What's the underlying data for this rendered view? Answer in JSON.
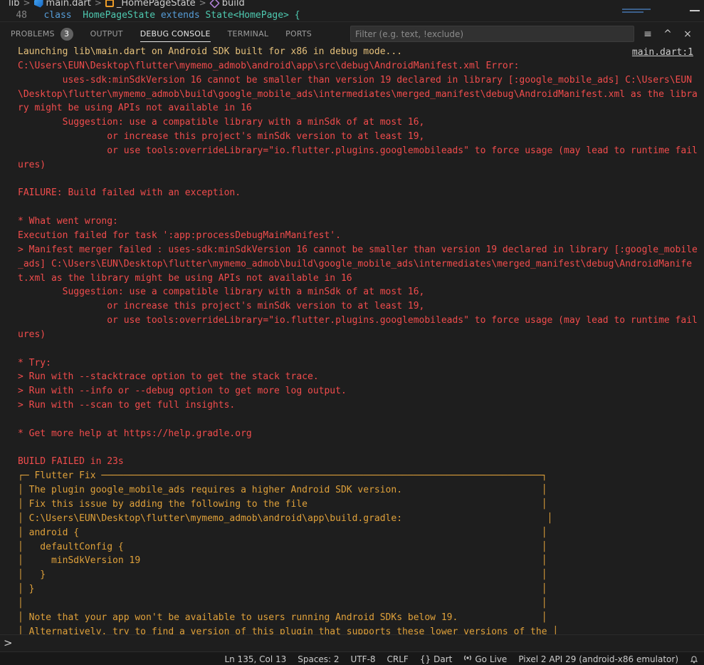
{
  "breadcrumb": {
    "items": [
      "lib",
      "main.dart",
      "_HomePageState",
      "build"
    ],
    "separator": ">"
  },
  "editor": {
    "line_number": "48",
    "code_keyword": "class",
    "code_rest_type": "HomePageState",
    "code_extends": "extends",
    "code_state": "State<HomePage> {"
  },
  "panel": {
    "tabs": [
      {
        "label": "PROBLEMS",
        "badge": "3"
      },
      {
        "label": "OUTPUT"
      },
      {
        "label": "DEBUG CONSOLE",
        "active": true
      },
      {
        "label": "TERMINAL"
      },
      {
        "label": "PORTS"
      }
    ],
    "filter_placeholder": "Filter (e.g. text, !exclude)",
    "actions": {
      "menu": "≡",
      "maximize": "^",
      "close": "×"
    }
  },
  "console": {
    "source_link": "main.dart:1",
    "lines": [
      {
        "text": "Launching lib\\main.dart on Android SDK built for x86 in debug mode...",
        "color": "yellow"
      },
      {
        "text": "C:\\Users\\EUN\\Desktop\\flutter\\mymemo_admob\\android\\app\\src\\debug\\AndroidManifest.xml Error:",
        "color": "red"
      },
      {
        "text": "        uses-sdk:minSdkVersion 16 cannot be smaller than version 19 declared in library [:google_mobile_ads] C:\\Users\\EUN",
        "color": "red"
      },
      {
        "text": "\\Desktop\\flutter\\mymemo_admob\\build\\google_mobile_ads\\intermediates\\merged_manifest\\debug\\AndroidManifest.xml as the libra",
        "color": "red"
      },
      {
        "text": "ry might be using APIs not available in 16",
        "color": "red"
      },
      {
        "text": "        Suggestion: use a compatible library with a minSdk of at most 16,",
        "color": "red"
      },
      {
        "text": "                or increase this project's minSdk version to at least 19,",
        "color": "red"
      },
      {
        "text": "                or use tools:overrideLibrary=\"io.flutter.plugins.googlemobileads\" to force usage (may lead to runtime fail",
        "color": "red"
      },
      {
        "text": "ures)",
        "color": "red"
      },
      {
        "text": "",
        "color": "red"
      },
      {
        "text": "FAILURE: Build failed with an exception.",
        "color": "red"
      },
      {
        "text": "",
        "color": "red"
      },
      {
        "text": "* What went wrong:",
        "color": "red"
      },
      {
        "text": "Execution failed for task ':app:processDebugMainManifest'.",
        "color": "red"
      },
      {
        "text": "> Manifest merger failed : uses-sdk:minSdkVersion 16 cannot be smaller than version 19 declared in library [:google_mobile",
        "color": "red"
      },
      {
        "text": "_ads] C:\\Users\\EUN\\Desktop\\flutter\\mymemo_admob\\build\\google_mobile_ads\\intermediates\\merged_manifest\\debug\\AndroidManife",
        "color": "red"
      },
      {
        "text": "t.xml as the library might be using APIs not available in 16",
        "color": "red"
      },
      {
        "text": "        Suggestion: use a compatible library with a minSdk of at most 16,",
        "color": "red"
      },
      {
        "text": "                or increase this project's minSdk version to at least 19,",
        "color": "red"
      },
      {
        "text": "                or use tools:overrideLibrary=\"io.flutter.plugins.googlemobileads\" to force usage (may lead to runtime fail",
        "color": "red"
      },
      {
        "text": "ures)",
        "color": "red"
      },
      {
        "text": "",
        "color": "red"
      },
      {
        "text": "* Try:",
        "color": "red"
      },
      {
        "text": "> Run with --stacktrace option to get the stack trace.",
        "color": "red"
      },
      {
        "text": "> Run with --info or --debug option to get more log output.",
        "color": "red"
      },
      {
        "text": "> Run with --scan to get full insights.",
        "color": "red"
      },
      {
        "text": "",
        "color": "red"
      },
      {
        "text": "* Get more help at https://help.gradle.org",
        "color": "red"
      },
      {
        "text": "",
        "color": "red"
      },
      {
        "text": "BUILD FAILED in 23s",
        "color": "red"
      },
      {
        "text": "┌─ Flutter Fix ───────────────────────────────────────────────────────────────────────────────┐",
        "color": "orange"
      },
      {
        "text": "│ The plugin google_mobile_ads requires a higher Android SDK version.                         │",
        "color": "orange"
      },
      {
        "text": "│ Fix this issue by adding the following to the file                                          │",
        "color": "orange"
      },
      {
        "text": "│ C:\\Users\\EUN\\Desktop\\flutter\\mymemo_admob\\android\\app\\build.gradle:                          │",
        "color": "orange"
      },
      {
        "text": "│ android {                                                                                   │",
        "color": "orange"
      },
      {
        "text": "│   defaultConfig {                                                                           │",
        "color": "orange"
      },
      {
        "text": "│     minSdkVersion 19                                                                        │",
        "color": "orange"
      },
      {
        "text": "│   }                                                                                         │",
        "color": "orange"
      },
      {
        "text": "│ }                                                                                           │",
        "color": "orange"
      },
      {
        "text": "│                                                                                             │",
        "color": "orange"
      },
      {
        "text": "│ Note that your app won't be available to users running Android SDKs below 19.               │",
        "color": "orange"
      },
      {
        "text": "│ Alternatively, try to find a version of this plugin that supports these lower versions of the │",
        "color": "orange"
      }
    ]
  },
  "prompt": {
    "symbol": ">"
  },
  "statusbar": {
    "position": "Ln 135, Col 13",
    "spaces": "Spaces: 2",
    "encoding": "UTF-8",
    "eol": "CRLF",
    "language": "Dart",
    "language_icon": "{}",
    "golive": "Go Live",
    "device": "Pixel 2 API 29 (android-x86 emulator)"
  },
  "colors": {
    "yellow": "#e5c07b",
    "red": "#f14c4c",
    "orange": "#e0a13a"
  }
}
